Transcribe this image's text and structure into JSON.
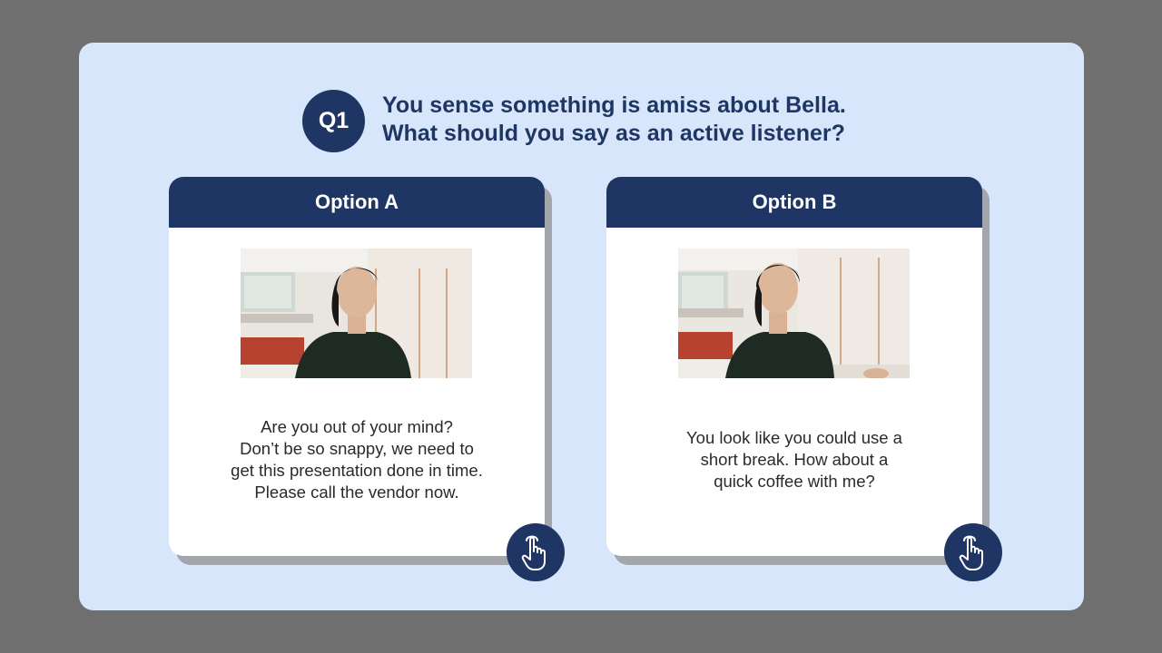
{
  "question": {
    "badge": "Q1",
    "line1": "You sense something is amiss about Bella.",
    "line2": "What should you say as an active listener?"
  },
  "options": [
    {
      "header": "Option A",
      "lines": [
        "Are you out of your mind?",
        "Don’t be so snappy, we need to",
        "get this presentation done in time.",
        "Please call the vendor now."
      ],
      "button_icon": "hand-pointer-icon"
    },
    {
      "header": "Option B",
      "lines": [
        "You look like you could use a",
        "short break. How about a",
        "quick coffee with me?"
      ],
      "button_icon": "hand-pointer-icon"
    }
  ],
  "colors": {
    "background": "#6f6f6f",
    "slide": "#d8e6fc",
    "accent": "#1f3564",
    "card": "#ffffff",
    "shadow": "#a3a6ad"
  }
}
